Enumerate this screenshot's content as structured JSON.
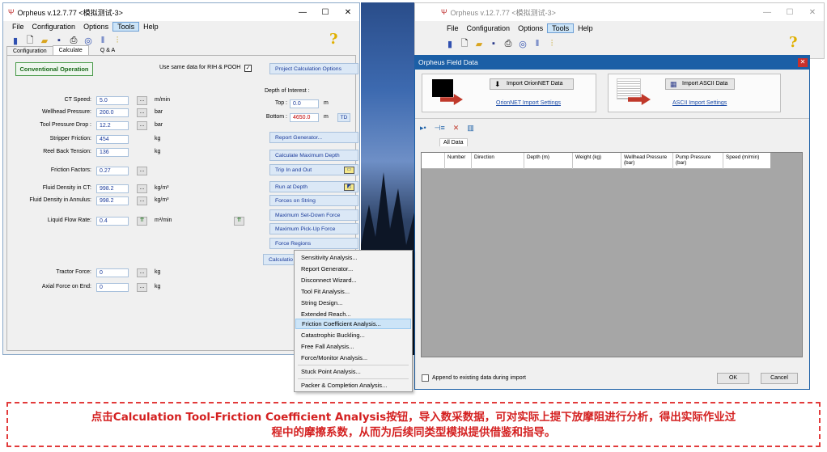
{
  "left_window": {
    "title": "Orpheus v.12.7.77 <模拟测试-3>",
    "menu": [
      "File",
      "Configuration",
      "Options",
      "Tools",
      "Help"
    ],
    "active_menu": "Tools",
    "tabs": [
      "Configuration",
      "Calculate",
      "Q & A"
    ],
    "selected_tab": "Calculate",
    "mode_button": "Conventional Operation",
    "same_data_label": "Use same data for RIH & POOH",
    "same_data_checked": "✓",
    "fields": [
      {
        "label": "CT Speed:",
        "value": "5.0",
        "unit": "m/min"
      },
      {
        "label": "Wellhead Pressure:",
        "value": "200.0",
        "unit": "bar"
      },
      {
        "label": "Tool Pressure Drop :",
        "value": "12.2",
        "unit": "bar"
      },
      {
        "label": "Stripper Friction:",
        "value": "454",
        "unit": "kg"
      },
      {
        "label": "Reel Back Tension:",
        "value": "136",
        "unit": "kg"
      },
      {
        "label": "Friction Factors:",
        "value": "0.27",
        "unit": ""
      },
      {
        "label": "Fluid Density in CT:",
        "value": "998.2",
        "unit": "kg/m³"
      },
      {
        "label": "Fluid Density in Annulus:",
        "value": "998.2",
        "unit": "kg/m³"
      },
      {
        "label": "Liquid Flow Rate:",
        "value": "0.4",
        "unit": "m³/min"
      },
      {
        "label": "Tractor Force:",
        "value": "0",
        "unit": "kg"
      },
      {
        "label": "Axial Force on End:",
        "value": "0",
        "unit": "kg"
      }
    ],
    "dots_label": "...",
    "depth": {
      "title": "Depth of Interest :",
      "top_label": "Top :",
      "top_value": "0.0",
      "bottom_label": "Bottom :",
      "bottom_value": "4650.0",
      "unit": "m",
      "td_label": "TD"
    },
    "right_buttons": [
      "Project Calculation Options",
      "Report Generator...",
      "Calculate Maximum Depth",
      "Trip In and Out",
      "Run at Depth",
      "Forces on String",
      "Maximum Set-Down Force",
      "Maximum Pick-Up Force",
      "Force Regions",
      "Calculation Tools"
    ],
    "calc_tools_visible": "Calculatio"
  },
  "calc_menu": {
    "items": [
      "Sensitivity Analysis...",
      "Report Generator...",
      "Disconnect Wizard...",
      "Tool Fit Analysis...",
      "String Design...",
      "Extended Reach...",
      "Friction Coefficient Analysis...",
      "Catastrophic Buckling...",
      "Free Fall Analysis...",
      "Force/Monitor Analysis...",
      "Stuck Point Analysis...",
      "Packer & Completion Analysis..."
    ],
    "highlighted": "Friction Coefficient Analysis..."
  },
  "right_window": {
    "title": "Orpheus v.12.7.77 <模拟测试-3>",
    "menu": [
      "File",
      "Configuration",
      "Options",
      "Tools",
      "Help"
    ],
    "active_menu": "Tools"
  },
  "field_data_dialog": {
    "title": "Orpheus Field Data",
    "orionnet_button": "Import OrionNET Data",
    "orionnet_link": "OrionNET Import Settings",
    "ascii_button": "Import ASCII Data",
    "ascii_link": "ASCII Import Settings",
    "tab": "All Data",
    "columns": [
      "Number",
      "Direction",
      "Depth (m)",
      "Weight (kg)",
      "Wellhead Pressure (bar)",
      "Pump Pressure (bar)",
      "Speed (m/min)"
    ],
    "append_label": "Append to existing data during import",
    "ok_label": "OK",
    "cancel_label": "Cancel"
  },
  "caption": {
    "line1": "点击Calculation Tool-Friction Coefficient Analysis按钮，导入数采数据，可对实际上提下放摩阻进行分析，得出实际作业过",
    "line2": "程中的摩擦系数，从而为后续同类型模拟提供借鉴和指导。"
  },
  "colors": {
    "accent_blue": "#1b5fa6",
    "caption_red": "#d42020",
    "menu_highlight": "#cce4f7"
  }
}
